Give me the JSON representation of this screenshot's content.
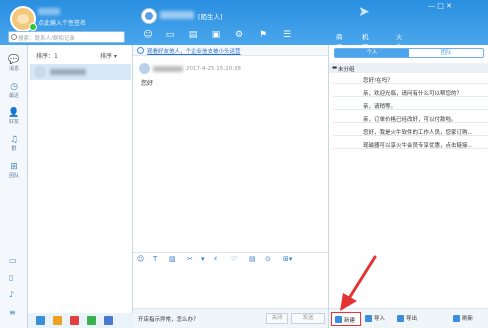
{
  "header": {
    "signature": "点此输入个性签名",
    "search_placeholder": "搜索：联系人/群和记录",
    "chat_tag": "[陌生人]",
    "right_tabs": [
      "商品",
      "机器人",
      "火牛"
    ],
    "window_controls": "— □ ✕"
  },
  "leftnav": {
    "items": [
      {
        "icon": "💬",
        "label": "消息"
      },
      {
        "icon": "◷",
        "label": "最近"
      },
      {
        "icon": "👤",
        "label": "好友"
      },
      {
        "icon": "♫",
        "label": "群"
      },
      {
        "icon": "⊞",
        "label": "团队"
      }
    ]
  },
  "convlist": {
    "sort_label": "排序：1",
    "sort_button": "排序 ▾"
  },
  "chat": {
    "notice": "观看好友他人，个企业信支被小头运营",
    "time": "2017-4-25 15:20:38",
    "message": "您好",
    "hint": "开店指示异常，怎么办？",
    "close_label": "关闭",
    "send_label": "发送"
  },
  "rightpanel": {
    "tab_personal": "个人",
    "tab_team": "团队",
    "group_name": "未分组",
    "replies": [
      "您好!在吗？",
      "亲，欢迎光临，请问有什么可以帮您的？",
      "亲，请稍等。",
      "亲，订单价格已经改好，可以付款啦。",
      "您好，我是火牛软件的工作人员，您家订购...",
      "现磁器可以享火牛会员专享优惠，点击链接..."
    ],
    "new_label": "新建",
    "import_label": "导入",
    "export_label": "导出",
    "refresh_label": "刷新"
  },
  "colors": {
    "header_blue": "#2a8fe0",
    "accent_red": "#e33333"
  }
}
